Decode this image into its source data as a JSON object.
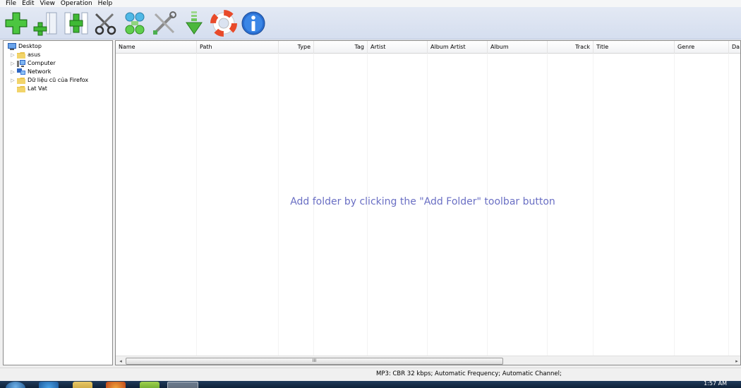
{
  "menu": [
    "File",
    "Edit",
    "View",
    "Operation",
    "Help"
  ],
  "toolbar": {
    "buttons": [
      {
        "name": "add-folder-icon"
      },
      {
        "name": "add-files-icon"
      },
      {
        "name": "add-sub-icon"
      },
      {
        "name": "cut-icon"
      },
      {
        "name": "join-icon"
      },
      {
        "name": "tools-icon"
      },
      {
        "name": "download-icon"
      },
      {
        "name": "help-lifebuoy-icon"
      },
      {
        "name": "info-icon"
      }
    ]
  },
  "tree": {
    "items": [
      {
        "label": "Desktop",
        "icon": "desktop-icon",
        "expandable": false
      },
      {
        "label": "asus",
        "icon": "folder-icon",
        "expandable": true
      },
      {
        "label": "Computer",
        "icon": "computer-icon",
        "expandable": true
      },
      {
        "label": "Network",
        "icon": "network-icon",
        "expandable": true
      },
      {
        "label": "Dữ liệu cũ của Firefox",
        "icon": "folder-icon",
        "expandable": true
      },
      {
        "label": "Lat Vat",
        "icon": "folder-icon",
        "expandable": false
      }
    ]
  },
  "list": {
    "columns": [
      "Name",
      "Path",
      "Type",
      "Tag",
      "Artist",
      "Album Artist",
      "Album",
      "Track",
      "Title",
      "Genre",
      "Da"
    ],
    "empty_message": "Add folder by clicking the \"Add Folder\" toolbar button",
    "scroll_grip": "III"
  },
  "status": {
    "text": "MP3:  CBR  32 kbps; Automatic Frequency; Automatic Channel;"
  },
  "taskbar": {
    "clock": "1:57 AM"
  },
  "colors": {
    "message": "#6a6fc4",
    "toolbar_bg": "#dbe3f1"
  }
}
